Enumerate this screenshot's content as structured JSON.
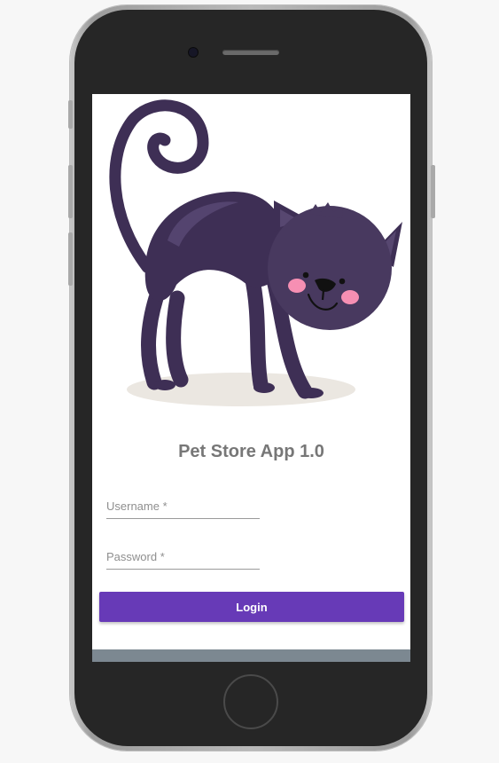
{
  "app": {
    "title": "Pet Store App 1.0"
  },
  "form": {
    "username_placeholder": "Username *",
    "password_placeholder": "Password *",
    "login_label": "Login"
  },
  "colors": {
    "accent": "#673ab7",
    "cat_body": "#3e2f55",
    "title_text": "#777777"
  },
  "icons": {
    "hero": "black-cat-illustration"
  }
}
